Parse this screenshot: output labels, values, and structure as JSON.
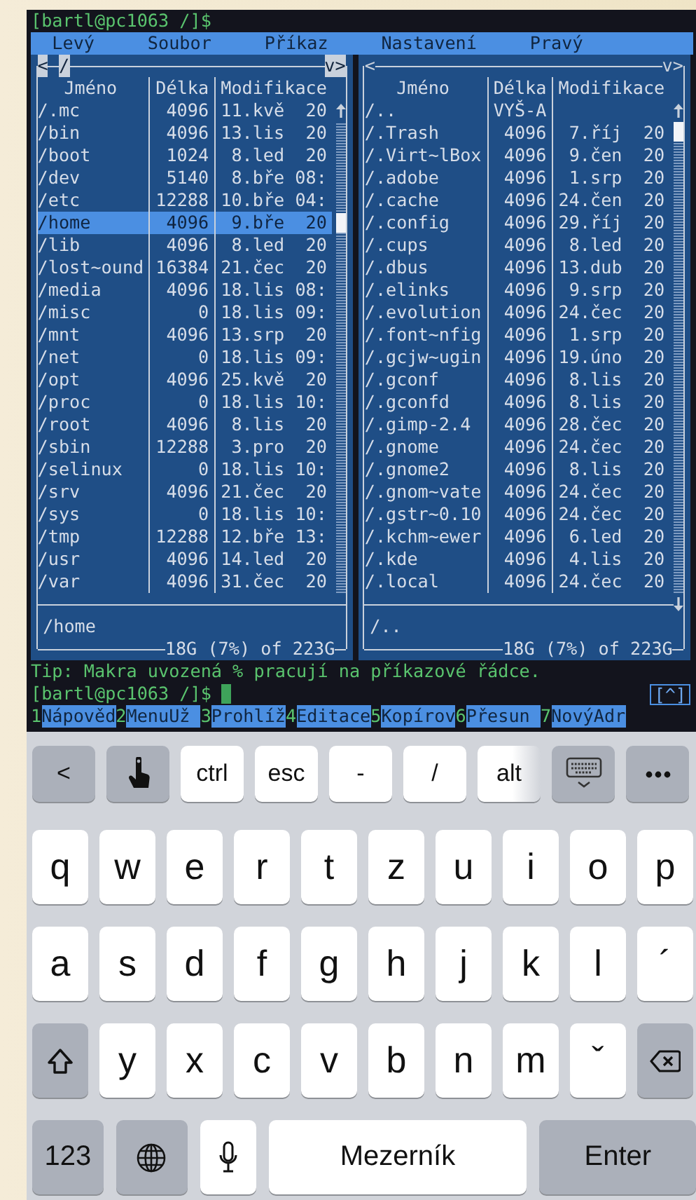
{
  "terminal": {
    "title_line": "[bartl@pc1063 /]$",
    "menu": [
      "Levý",
      "Soubor",
      "Příkaz",
      "Nastavení",
      "Pravý"
    ],
    "panels": [
      {
        "active": true,
        "nav_left": "<",
        "path": "/",
        "nav_right": "v>",
        "columns": [
          "Jméno",
          "Délka",
          "Modifikace"
        ],
        "rows": [
          {
            "name": "/.mc",
            "size": "4096",
            "modified": "11.kvě  20",
            "selected": false
          },
          {
            "name": "/bin",
            "size": "4096",
            "modified": "13.lis  20",
            "selected": false
          },
          {
            "name": "/boot",
            "size": "1024",
            "modified": "8.led  20",
            "selected": false
          },
          {
            "name": "/dev",
            "size": "5140",
            "modified": "8.bře 08:",
            "selected": false
          },
          {
            "name": "/etc",
            "size": "12288",
            "modified": "10.bře 04:",
            "selected": false
          },
          {
            "name": "/home",
            "size": "4096",
            "modified": "9.bře  20",
            "selected": true
          },
          {
            "name": "/lib",
            "size": "4096",
            "modified": "8.led  20",
            "selected": false
          },
          {
            "name": "/lost~ound",
            "size": "16384",
            "modified": "21.čec  20",
            "selected": false
          },
          {
            "name": "/media",
            "size": "4096",
            "modified": "18.lis 08:",
            "selected": false
          },
          {
            "name": "/misc",
            "size": "0",
            "modified": "18.lis 09:",
            "selected": false
          },
          {
            "name": "/mnt",
            "size": "4096",
            "modified": "13.srp  20",
            "selected": false
          },
          {
            "name": "/net",
            "size": "0",
            "modified": "18.lis 09:",
            "selected": false
          },
          {
            "name": "/opt",
            "size": "4096",
            "modified": "25.kvě  20",
            "selected": false
          },
          {
            "name": "/proc",
            "size": "0",
            "modified": "18.lis 10:",
            "selected": false
          },
          {
            "name": "/root",
            "size": "4096",
            "modified": "8.lis  20",
            "selected": false
          },
          {
            "name": "/sbin",
            "size": "12288",
            "modified": "3.pro  20",
            "selected": false
          },
          {
            "name": "/selinux",
            "size": "0",
            "modified": "18.lis 10:",
            "selected": false
          },
          {
            "name": "/srv",
            "size": "4096",
            "modified": "21.čec  20",
            "selected": false
          },
          {
            "name": "/sys",
            "size": "0",
            "modified": "18.lis 10:",
            "selected": false
          },
          {
            "name": "/tmp",
            "size": "12288",
            "modified": "12.bře 13:",
            "selected": false
          },
          {
            "name": "/usr",
            "size": "4096",
            "modified": "14.led  20",
            "selected": false
          },
          {
            "name": "/var",
            "size": "4096",
            "modified": "31.čec  20",
            "selected": false
          }
        ],
        "mini_status": "/home",
        "disk": "18G (7%) of 223G"
      },
      {
        "active": false,
        "nav_left": "<",
        "nav_right": "v>",
        "columns": [
          "Jméno",
          "Délka",
          "Modifikace"
        ],
        "rows": [
          {
            "name": "/..",
            "size": "VYŠ-A",
            "selected": false
          },
          {
            "name": "/.Trash",
            "size": "4096",
            "modified": "7.říj  20",
            "selected": false
          },
          {
            "name": "/.Virt~lBox",
            "size": "4096",
            "modified": "9.čen  20",
            "selected": false
          },
          {
            "name": "/.adobe",
            "size": "4096",
            "modified": "1.srp  20",
            "selected": false
          },
          {
            "name": "/.cache",
            "size": "4096",
            "modified": "24.čen  20",
            "selected": false
          },
          {
            "name": "/.config",
            "size": "4096",
            "modified": "29.říj  20",
            "selected": false
          },
          {
            "name": "/.cups",
            "size": "4096",
            "modified": "8.led  20",
            "selected": false
          },
          {
            "name": "/.dbus",
            "size": "4096",
            "modified": "13.dub  20",
            "selected": false
          },
          {
            "name": "/.elinks",
            "size": "4096",
            "modified": "9.srp  20",
            "selected": false
          },
          {
            "name": "/.evolution",
            "size": "4096",
            "modified": "24.čec  20",
            "selected": false
          },
          {
            "name": "/.font~nfig",
            "size": "4096",
            "modified": "1.srp  20",
            "selected": false
          },
          {
            "name": "/.gcjw~ugin",
            "size": "4096",
            "modified": "19.úno  20",
            "selected": false
          },
          {
            "name": "/.gconf",
            "size": "4096",
            "modified": "8.lis  20",
            "selected": false
          },
          {
            "name": "/.gconfd",
            "size": "4096",
            "modified": "8.lis  20",
            "selected": false
          },
          {
            "name": "/.gimp-2.4",
            "size": "4096",
            "modified": "28.čec  20",
            "selected": false
          },
          {
            "name": "/.gnome",
            "size": "4096",
            "modified": "24.čec  20",
            "selected": false
          },
          {
            "name": "/.gnome2",
            "size": "4096",
            "modified": "8.lis  20",
            "selected": false
          },
          {
            "name": "/.gnom~vate",
            "size": "4096",
            "modified": "24.čec  20",
            "selected": false
          },
          {
            "name": "/.gstr~0.10",
            "size": "4096",
            "modified": "24.čec  20",
            "selected": false
          },
          {
            "name": "/.kchm~ewer",
            "size": "4096",
            "modified": "6.led  20",
            "selected": false
          },
          {
            "name": "/.kde",
            "size": "4096",
            "modified": "4.lis  20",
            "selected": false
          },
          {
            "name": "/.local",
            "size": "4096",
            "modified": "24.čec  20",
            "selected": false
          }
        ],
        "mini_status": "/..",
        "disk": "18G (7%) of 223G"
      }
    ],
    "tip": "Tip: Makra uvozená % pracují na příkazové řádce.",
    "prompt": "[bartl@pc1063 /]$",
    "scroll_hint": "[^]",
    "function_keys": [
      {
        "number": "1",
        "label": "Nápověd"
      },
      {
        "number": "2",
        "label": "MenuUž"
      },
      {
        "number": "3",
        "label": "Prohlíž"
      },
      {
        "number": "4",
        "label": "Editace"
      },
      {
        "number": "5",
        "label": "Kopírov"
      },
      {
        "number": "6",
        "label": "Přesun"
      },
      {
        "number": "7",
        "label": "NovýAdr"
      }
    ]
  },
  "keyboard": {
    "toolbar": [
      {
        "kind": "gray",
        "label": "<"
      },
      {
        "kind": "pointer"
      },
      {
        "kind": "white",
        "label": "ctrl"
      },
      {
        "kind": "white",
        "label": "esc"
      },
      {
        "kind": "white",
        "label": "-"
      },
      {
        "kind": "white",
        "label": "/"
      },
      {
        "kind": "faded",
        "label": "alt"
      },
      {
        "kind": "hide"
      },
      {
        "kind": "more"
      }
    ],
    "rows": [
      [
        {
          "kind": "letter",
          "label": "q"
        },
        {
          "kind": "letter",
          "label": "w"
        },
        {
          "kind": "letter",
          "label": "e"
        },
        {
          "kind": "letter",
          "label": "r"
        },
        {
          "kind": "letter",
          "label": "t"
        },
        {
          "kind": "letter",
          "label": "z"
        },
        {
          "kind": "letter",
          "label": "u"
        },
        {
          "kind": "letter",
          "label": "i"
        },
        {
          "kind": "letter",
          "label": "o"
        },
        {
          "kind": "letter",
          "label": "p"
        }
      ],
      [
        {
          "kind": "letter",
          "label": "a"
        },
        {
          "kind": "letter",
          "label": "s"
        },
        {
          "kind": "letter",
          "label": "d"
        },
        {
          "kind": "letter",
          "label": "f"
        },
        {
          "kind": "letter",
          "label": "g"
        },
        {
          "kind": "letter",
          "label": "h"
        },
        {
          "kind": "letter",
          "label": "j"
        },
        {
          "kind": "letter",
          "label": "k"
        },
        {
          "kind": "letter",
          "label": "l"
        },
        {
          "kind": "letter",
          "label": "´"
        }
      ],
      [
        {
          "kind": "shift"
        },
        {
          "kind": "letter",
          "label": "y"
        },
        {
          "kind": "letter",
          "label": "x"
        },
        {
          "kind": "letter",
          "label": "c"
        },
        {
          "kind": "letter",
          "label": "v"
        },
        {
          "kind": "letter",
          "label": "b"
        },
        {
          "kind": "letter",
          "label": "n"
        },
        {
          "kind": "letter",
          "label": "m"
        },
        {
          "kind": "letter",
          "label": "ˇ"
        },
        {
          "kind": "backspace"
        }
      ]
    ],
    "bottom": [
      {
        "kind": "gray",
        "label": "123"
      },
      {
        "kind": "globe"
      },
      {
        "kind": "mic"
      },
      {
        "kind": "space",
        "label": "Mezerník"
      },
      {
        "kind": "gray",
        "label": "Enter"
      }
    ]
  }
}
